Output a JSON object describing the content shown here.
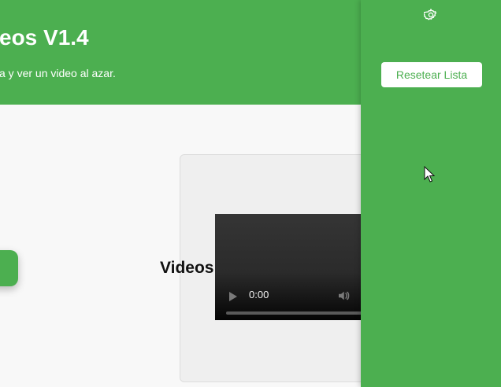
{
  "header": {
    "title": "eos V1.4",
    "subtitle": "a y ver un video al azar."
  },
  "main": {
    "left_action": {
      "icon": "green-action-button"
    },
    "video_card": {
      "label": "Videos",
      "player": {
        "time": "0:00"
      }
    }
  },
  "side_panel": {
    "settings_icon": "gear-icon",
    "reset_label": "Resetear Lista"
  },
  "colors": {
    "accent": "#4caf50",
    "background": "#f8f8f8",
    "card": "#efefef",
    "player": "#2b2b2b"
  }
}
